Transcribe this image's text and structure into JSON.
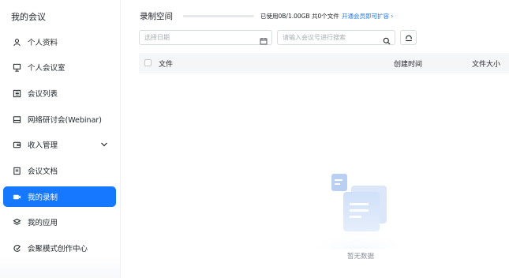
{
  "sidebar": {
    "title": "我的会议",
    "items": [
      {
        "label": "个人资料",
        "icon": "person-icon"
      },
      {
        "label": "个人会议室",
        "icon": "meeting-room-icon"
      },
      {
        "label": "会议列表",
        "icon": "list-icon"
      },
      {
        "label": "网络研讨会(Webinar)",
        "icon": "webinar-icon"
      },
      {
        "label": "收入管理",
        "icon": "income-icon"
      },
      {
        "label": "会议文档",
        "icon": "document-icon"
      },
      {
        "label": "我的录制",
        "icon": "recording-icon",
        "active": true
      },
      {
        "label": "我的应用",
        "icon": "apps-icon"
      },
      {
        "label": "会聚模式创作中心",
        "icon": "creation-center-icon"
      }
    ]
  },
  "main": {
    "title": "录制空间",
    "storage_text": "已使用0B/1.00GB 共0个文件",
    "storage_used_fraction": 0,
    "upgrade_link": "开通会员即可扩容 ›",
    "date_placeholder": "选择日期",
    "search_placeholder": "请输入会议号进行搜索",
    "table": {
      "columns": [
        "文件",
        "创建时间",
        "文件大小"
      ]
    },
    "empty_text": "暂无数据"
  },
  "colors": {
    "accent": "#1677ff",
    "text": "#1f2329",
    "muted": "#8a8f99",
    "border": "#d9dce1"
  }
}
